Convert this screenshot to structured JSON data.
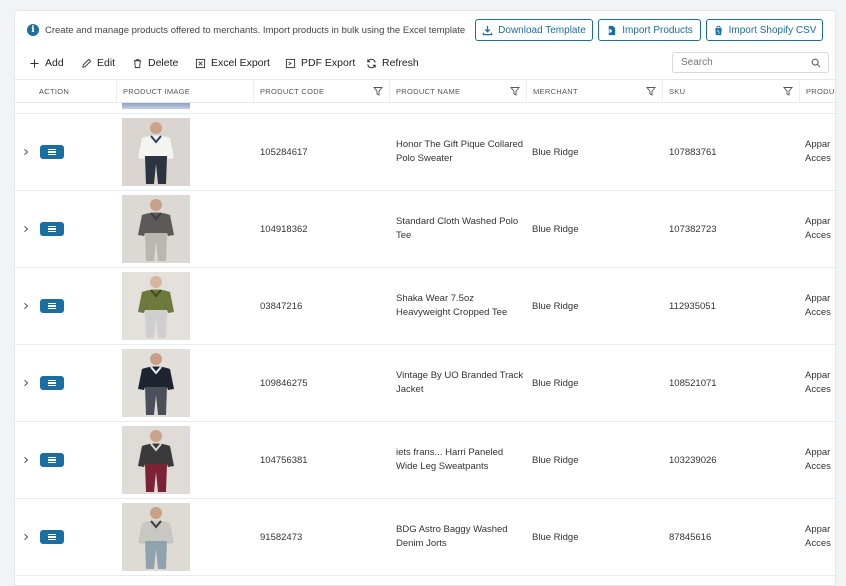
{
  "info": {
    "text": "Create and manage products offered to merchants. Import products in bulk using the Excel template or..."
  },
  "header_buttons": {
    "download_template": "Download Template",
    "import_products": "Import Products",
    "import_shopify": "Import Shopify CSV"
  },
  "toolbar": {
    "add": "Add",
    "edit": "Edit",
    "delete": "Delete",
    "excel_export": "Excel Export",
    "pdf_export": "PDF Export",
    "refresh": "Refresh",
    "search_placeholder": "Search"
  },
  "columns": {
    "action": "ACTION",
    "image": "PRODUCT IMAGE",
    "code": "PRODUCT CODE",
    "name": "PRODUCT NAME",
    "merchant": "MERCHANT",
    "sku": "SKU",
    "type": "PRODU"
  },
  "rows": [
    {
      "code": "105284617",
      "name": "Honor The Gift Pique Collared Polo Sweater",
      "merchant": "Blue Ridge",
      "sku": "107883761",
      "type_line1": "Appar",
      "type_line2": "Acces",
      "image_icon": "white-polo-model"
    },
    {
      "code": "104918362",
      "name": "Standard Cloth Washed Polo Tee",
      "merchant": "Blue Ridge",
      "sku": "107382723",
      "type_line1": "Appar",
      "type_line2": "Acces",
      "image_icon": "grey-polo-model"
    },
    {
      "code": "03847216",
      "name": "Shaka Wear 7.5oz Heavyweight Cropped Tee",
      "merchant": "Blue Ridge",
      "sku": "112935051",
      "type_line1": "Appar",
      "type_line2": "Acces",
      "image_icon": "camo-tee-model"
    },
    {
      "code": "109846275",
      "name": "Vintage By UO Branded Track Jacket",
      "merchant": "Blue Ridge",
      "sku": "108521071",
      "type_line1": "Appar",
      "type_line2": "Acces",
      "image_icon": "track-jacket-model"
    },
    {
      "code": "104756381",
      "name": "iets frans... Harri Paneled Wide Leg Sweatpants",
      "merchant": "Blue Ridge",
      "sku": "103239026",
      "type_line1": "Appar",
      "type_line2": "Acces",
      "image_icon": "sweatpants-model"
    },
    {
      "code": "91582473",
      "name": "BDG Astro Baggy Washed Denim Jorts",
      "merchant": "Blue Ridge",
      "sku": "87845616",
      "type_line1": "Appar",
      "type_line2": "Acces",
      "image_icon": "denim-jorts-model"
    }
  ],
  "colors": {
    "accent": "#1b6fa0",
    "border": "#e6e8eb"
  }
}
